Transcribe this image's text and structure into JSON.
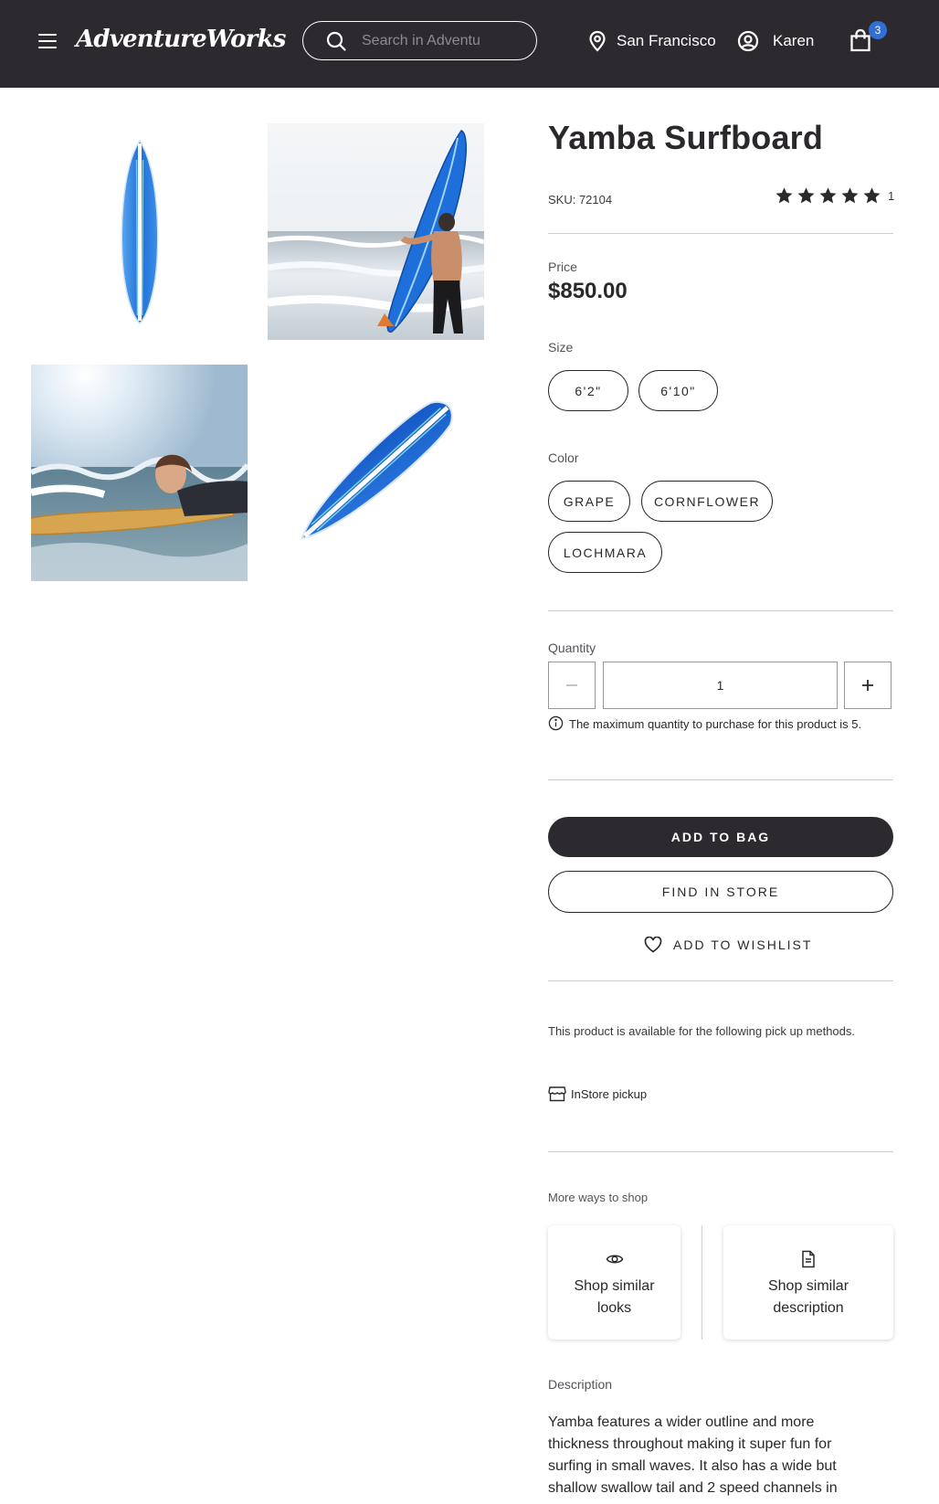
{
  "header": {
    "brand": "AdventureWorks",
    "search_placeholder": "Search in AdventureWorks",
    "location": "San Francisco",
    "user": "Karen",
    "cart_count": "3"
  },
  "product": {
    "title": "Yamba Surfboard",
    "sku": "SKU: 72104",
    "rating": 5,
    "rating_count": "1",
    "price_label": "Price",
    "price": "$850.00",
    "size_label": "Size",
    "sizes": [
      "6'2\"",
      "6'10\""
    ],
    "color_label": "Color",
    "colors": [
      "GRAPE",
      "CORNFLOWER",
      "LOCHMARA"
    ],
    "quantity_label": "Quantity",
    "quantity": "1",
    "max_note": "The maximum quantity to purchase for this product is 5.",
    "add_to_bag": "ADD TO BAG",
    "find_in_store": "FIND IN STORE",
    "add_to_wishlist": "ADD TO WISHLIST",
    "pickup_note": "This product is available for the following pick up methods.",
    "pickup_method": "InStore pickup",
    "more_ways_label": "More ways to shop",
    "shop_similar_looks": "Shop similar looks",
    "shop_similar_description": "Shop similar description",
    "description_label": "Description",
    "description": "Yamba features a wider outline and more thickness throughout making it super fun for surfing in small waves. It also has a wide but shallow swallow tail and 2 speed channels in"
  },
  "colors": {
    "header_bg": "#2c2a2f",
    "badge": "#2f6fd6",
    "board_blue": "#1e6fd9"
  },
  "icons": [
    "menu-icon",
    "search-icon",
    "location-pin-icon",
    "user-icon",
    "shopping-bag-icon",
    "star-icon",
    "minus-icon",
    "plus-icon",
    "info-icon",
    "heart-icon",
    "store-icon",
    "eye-icon",
    "document-icon"
  ]
}
